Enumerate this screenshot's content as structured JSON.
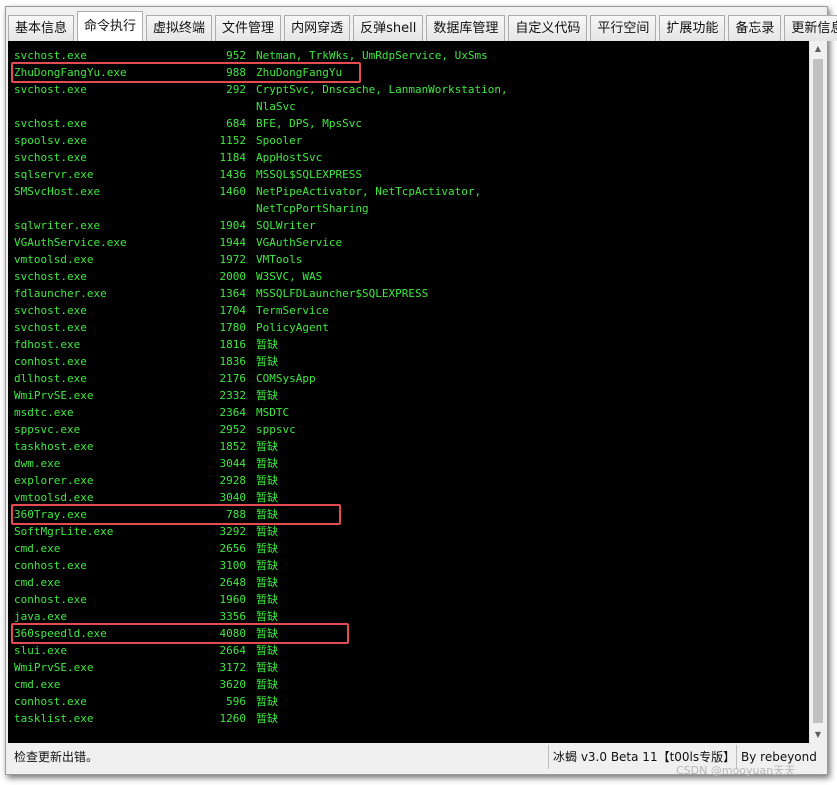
{
  "tabs": [
    {
      "label": "基本信息",
      "active": false
    },
    {
      "label": "命令执行",
      "active": true
    },
    {
      "label": "虚拟终端",
      "active": false
    },
    {
      "label": "文件管理",
      "active": false
    },
    {
      "label": "内网穿透",
      "active": false
    },
    {
      "label": "反弹shell",
      "active": false
    },
    {
      "label": "数据库管理",
      "active": false
    },
    {
      "label": "自定义代码",
      "active": false
    },
    {
      "label": "平行空间",
      "active": false
    },
    {
      "label": "扩展功能",
      "active": false
    },
    {
      "label": "备忘录",
      "active": false
    },
    {
      "label": "更新信息",
      "active": false
    }
  ],
  "console": {
    "rows": [
      {
        "name": "svchost.exe",
        "pid": "952",
        "svc": "Netman, TrkWks, UmRdpService, UxSms"
      },
      {
        "name": "ZhuDongFangYu.exe",
        "pid": "988",
        "svc": "ZhuDongFangYu",
        "highlight": true
      },
      {
        "name": "svchost.exe",
        "pid": "292",
        "svc": "CryptSvc, Dnscache, LanmanWorkstation,"
      },
      {
        "name": "",
        "pid": "",
        "svc": "NlaSvc"
      },
      {
        "name": "svchost.exe",
        "pid": "684",
        "svc": "BFE, DPS, MpsSvc"
      },
      {
        "name": "spoolsv.exe",
        "pid": "1152",
        "svc": "Spooler"
      },
      {
        "name": "svchost.exe",
        "pid": "1184",
        "svc": "AppHostSvc"
      },
      {
        "name": "sqlservr.exe",
        "pid": "1436",
        "svc": "MSSQL$SQLEXPRESS"
      },
      {
        "name": "SMSvcHost.exe",
        "pid": "1460",
        "svc": "NetPipeActivator, NetTcpActivator,"
      },
      {
        "name": "",
        "pid": "",
        "svc": "NetTcpPortSharing"
      },
      {
        "name": "sqlwriter.exe",
        "pid": "1904",
        "svc": "SQLWriter"
      },
      {
        "name": "VGAuthService.exe",
        "pid": "1944",
        "svc": "VGAuthService"
      },
      {
        "name": "vmtoolsd.exe",
        "pid": "1972",
        "svc": "VMTools"
      },
      {
        "name": "svchost.exe",
        "pid": "2000",
        "svc": "W3SVC, WAS"
      },
      {
        "name": "fdlauncher.exe",
        "pid": "1364",
        "svc": "MSSQLFDLauncher$SQLEXPRESS"
      },
      {
        "name": "svchost.exe",
        "pid": "1704",
        "svc": "TermService"
      },
      {
        "name": "svchost.exe",
        "pid": "1780",
        "svc": "PolicyAgent"
      },
      {
        "name": "fdhost.exe",
        "pid": "1816",
        "svc": "暂缺"
      },
      {
        "name": "conhost.exe",
        "pid": "1836",
        "svc": "暂缺"
      },
      {
        "name": "dllhost.exe",
        "pid": "2176",
        "svc": "COMSysApp"
      },
      {
        "name": "WmiPrvSE.exe",
        "pid": "2332",
        "svc": "暂缺"
      },
      {
        "name": "msdtc.exe",
        "pid": "2364",
        "svc": "MSDTC"
      },
      {
        "name": "sppsvc.exe",
        "pid": "2952",
        "svc": "sppsvc"
      },
      {
        "name": "taskhost.exe",
        "pid": "1852",
        "svc": "暂缺"
      },
      {
        "name": "dwm.exe",
        "pid": "3044",
        "svc": "暂缺"
      },
      {
        "name": "explorer.exe",
        "pid": "2928",
        "svc": "暂缺"
      },
      {
        "name": "vmtoolsd.exe",
        "pid": "3040",
        "svc": "暂缺"
      },
      {
        "name": "360Tray.exe",
        "pid": "788",
        "svc": "暂缺",
        "highlight": true
      },
      {
        "name": "SoftMgrLite.exe",
        "pid": "3292",
        "svc": "暂缺"
      },
      {
        "name": "cmd.exe",
        "pid": "2656",
        "svc": "暂缺"
      },
      {
        "name": "conhost.exe",
        "pid": "3100",
        "svc": "暂缺"
      },
      {
        "name": "cmd.exe",
        "pid": "2648",
        "svc": "暂缺"
      },
      {
        "name": "conhost.exe",
        "pid": "1960",
        "svc": "暂缺"
      },
      {
        "name": "java.exe",
        "pid": "3356",
        "svc": "暂缺"
      },
      {
        "name": "360speedld.exe",
        "pid": "4080",
        "svc": "暂缺",
        "highlight": true
      },
      {
        "name": "slui.exe",
        "pid": "2664",
        "svc": "暂缺"
      },
      {
        "name": "WmiPrvSE.exe",
        "pid": "3172",
        "svc": "暂缺"
      },
      {
        "name": "cmd.exe",
        "pid": "3620",
        "svc": "暂缺"
      },
      {
        "name": "conhost.exe",
        "pid": "596",
        "svc": "暂缺"
      },
      {
        "name": "tasklist.exe",
        "pid": "1260",
        "svc": "暂缺"
      }
    ]
  },
  "status": {
    "message": "检查更新出错。",
    "version": "冰蝎 v3.0 Beta 11【t00ls专版】",
    "author": "By rebeyond"
  },
  "watermark": "CSDN @mooyuan天天",
  "colors": {
    "console_text": "#3fe83f",
    "console_bg": "#000000",
    "highlight": "#e44c52"
  }
}
